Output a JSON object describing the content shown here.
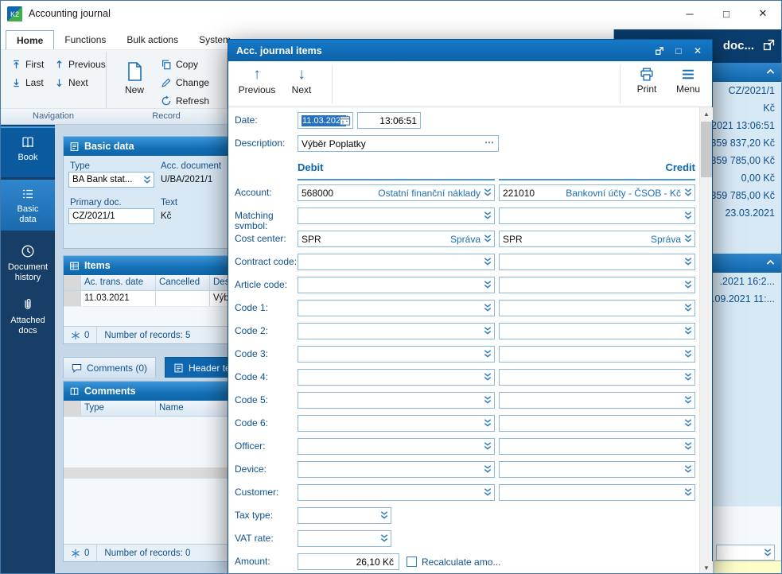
{
  "window": {
    "title": "Accounting journal"
  },
  "icons": {
    "minimize": "─",
    "maximize": "□",
    "close": "✕"
  },
  "tabs": {
    "items": [
      "Home",
      "Functions",
      "Bulk actions",
      "System"
    ],
    "selected": "Home"
  },
  "toolbar": {
    "first": "First",
    "previous": "Previous",
    "last": "Last",
    "next": "Next",
    "new": "New",
    "copy": "Copy",
    "change": "Change",
    "refresh": "Refresh",
    "groups": [
      {
        "label": "Navigation"
      },
      {
        "label": "Record"
      }
    ]
  },
  "sidebar": {
    "items": [
      {
        "id": "book",
        "label": "Book"
      },
      {
        "id": "basic-data",
        "label": "Basic data"
      },
      {
        "id": "document-history",
        "label": "Document history"
      },
      {
        "id": "attached-docs",
        "label": "Attached docs"
      }
    ]
  },
  "basic_data": {
    "title": "Basic data",
    "type_label": "Type",
    "type_value": "BA Bank stat...",
    "acc_document_label": "Acc. document",
    "acc_document_value": "U/BA/2021/1",
    "primary_doc_label": "Primary doc.",
    "primary_doc_value": "CZ/2021/1",
    "text_label": "Text",
    "text_value": "Kč"
  },
  "items": {
    "title": "Items",
    "columns": [
      "Ac. trans. date",
      "Cancelled",
      "Desc..."
    ],
    "rows": [
      {
        "date": "11.03.2021",
        "cancelled": "",
        "desc": "Výb..."
      }
    ],
    "frozen_count": "0",
    "records_text": "Number of records: 5"
  },
  "comment_tabs": {
    "comments": "Comments (0)",
    "header_text": "Header text ("
  },
  "comments": {
    "title": "Comments",
    "columns": [
      "Type",
      "Name"
    ],
    "frozen_count": "0",
    "records_text": "Number of records: 0"
  },
  "right_panel": {
    "title": "doc...",
    "values": [
      "CZ/2021/1",
      "Kč",
      ".2021 13:06:51",
      "359 837,20 Kč",
      "359 785,00 Kč",
      "0,00 Kč",
      "359 785,00 Kč",
      "23.03.2021"
    ],
    "values2": [
      ".2021 16:2...",
      ".09.2021 11:..."
    ]
  },
  "modal": {
    "title": "Acc. journal items",
    "toolbar": {
      "previous": "Previous",
      "next": "Next",
      "print": "Print",
      "menu": "Menu"
    },
    "date_label": "Date:",
    "date_value": "11.03.2021",
    "time_value": "13:06:51",
    "description_label": "Description:",
    "description_value": "Výběr Poplatky",
    "debit_header": "Debit",
    "credit_header": "Credit",
    "rows": [
      {
        "id": "account",
        "label": "Account:",
        "kind": "pair",
        "debit": {
          "code": "568000",
          "name": "Ostatní finanční náklady"
        },
        "credit": {
          "code": "221010",
          "name": "Bankovní účty - ČSOB - Kč"
        }
      },
      {
        "id": "matching-symbol",
        "label": "Matching symbol:",
        "kind": "pair"
      },
      {
        "id": "cost-center",
        "label": "Cost center:",
        "kind": "pair",
        "debit": {
          "code": "SPR",
          "name": "Správa"
        },
        "credit": {
          "code": "SPR",
          "name": "Správa"
        }
      },
      {
        "id": "contract-code",
        "label": "Contract code:",
        "kind": "pair"
      },
      {
        "id": "article-code",
        "label": "Article code:",
        "kind": "pair"
      },
      {
        "id": "code-1",
        "label": "Code 1:",
        "kind": "pair"
      },
      {
        "id": "code-2",
        "label": "Code 2:",
        "kind": "pair"
      },
      {
        "id": "code-3",
        "label": "Code 3:",
        "kind": "pair"
      },
      {
        "id": "code-4",
        "label": "Code 4:",
        "kind": "pair"
      },
      {
        "id": "code-5",
        "label": "Code 5:",
        "kind": "pair"
      },
      {
        "id": "code-6",
        "label": "Code 6:",
        "kind": "pair"
      },
      {
        "id": "officer",
        "label": "Officer:",
        "kind": "pair"
      },
      {
        "id": "device",
        "label": "Device:",
        "kind": "pair"
      },
      {
        "id": "customer",
        "label": "Customer:",
        "kind": "pair"
      },
      {
        "id": "tax-type",
        "label": "Tax type:",
        "kind": "single"
      },
      {
        "id": "vat-rate",
        "label": "VAT rate:",
        "kind": "single"
      },
      {
        "id": "amount",
        "label": "Amount:",
        "kind": "amount",
        "value": "26,10 Kč",
        "checkbox_label": "Recalculate amo..."
      }
    ]
  },
  "colors": {
    "accent": "#1b6fb5",
    "modal_title": "#0e68b2",
    "selection": "#2471c4"
  }
}
